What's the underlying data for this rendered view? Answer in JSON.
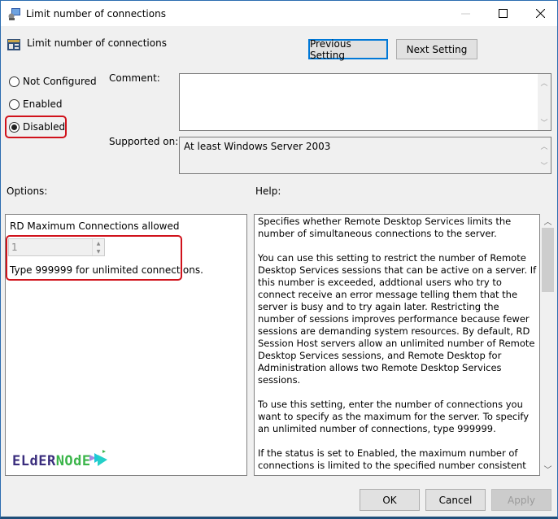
{
  "window": {
    "title": "Limit number of connections",
    "controls": {
      "minimize": "—",
      "maximize": "☐",
      "close": "✕"
    }
  },
  "header": {
    "setting_title": "Limit number of connections",
    "previous_label": "Previous Setting",
    "next_label": "Next Setting"
  },
  "state": {
    "options": [
      {
        "label": "Not Configured",
        "checked": false
      },
      {
        "label": "Enabled",
        "checked": false
      },
      {
        "label": "Disabled",
        "checked": true
      }
    ]
  },
  "comment": {
    "label": "Comment:",
    "value": ""
  },
  "supported": {
    "label": "Supported on:",
    "value": "At least Windows Server 2003"
  },
  "options_panel": {
    "heading": "Options:",
    "field_label": "RD Maximum Connections allowed",
    "spin_value": "1",
    "hint": "Type 999999 for unlimited connections."
  },
  "help_panel": {
    "heading": "Help:",
    "paragraphs": [
      "Specifies whether Remote Desktop Services limits the number of simultaneous connections to the server.",
      "You can use this setting to restrict the number of Remote Desktop Services sessions that can be active on a server. If this number is exceeded, addtional users who try to connect receive an error message telling them that the server is busy and to try again later. Restricting the number of sessions improves performance because fewer sessions are demanding system resources. By default, RD Session Host servers allow an unlimited number of Remote Desktop Services sessions, and Remote Desktop for Administration allows two Remote Desktop Services sessions.",
      "To use this setting, enter the number of connections you want to specify as the maximum for the server. To specify an unlimited number of connections, type 999999.",
      "If the status is set to Enabled, the maximum number of connections is limited to the specified number consistent with the version of Windows and the mode of Remote Desktop"
    ]
  },
  "watermark": {
    "part1": "ELdER",
    "part2": "NOdE"
  },
  "footer": {
    "ok_label": "OK",
    "cancel_label": "Cancel",
    "apply_label": "Apply"
  },
  "colors": {
    "highlight": "#d0121b",
    "focus": "#0078d7",
    "brand_purple": "#3a2d7d",
    "brand_green": "#3bb54a"
  }
}
